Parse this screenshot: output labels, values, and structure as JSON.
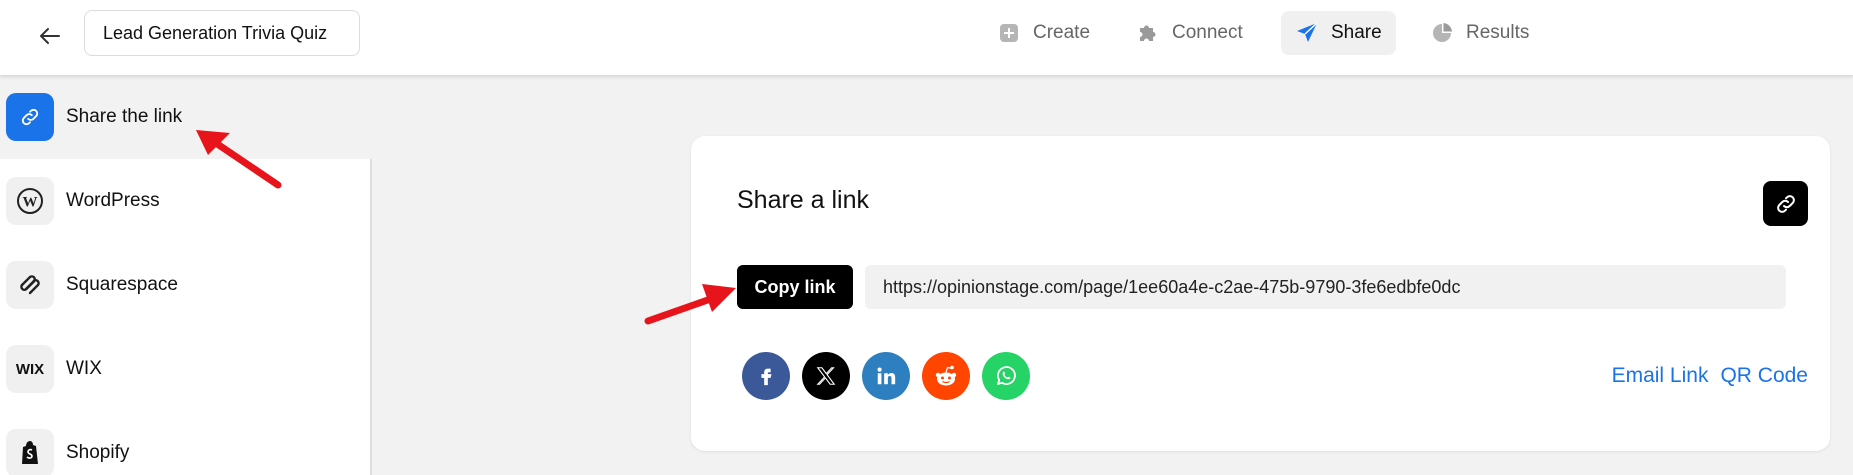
{
  "header": {
    "title": "Lead Generation Trivia Quiz",
    "nav": [
      {
        "label": "Create",
        "icon": "plus-square-icon",
        "active": false
      },
      {
        "label": "Connect",
        "icon": "puzzle-icon",
        "active": false
      },
      {
        "label": "Share",
        "icon": "paper-plane-icon",
        "active": true
      },
      {
        "label": "Results",
        "icon": "pie-chart-icon",
        "active": false
      }
    ]
  },
  "sidebar": {
    "items": [
      {
        "label": "Share the link",
        "icon": "link-icon",
        "active": true
      },
      {
        "label": "WordPress",
        "icon": "wordpress-icon",
        "active": false
      },
      {
        "label": "Squarespace",
        "icon": "squarespace-icon",
        "active": false
      },
      {
        "label": "WIX",
        "icon": "wix-icon",
        "icon_text": "WIX",
        "active": false
      },
      {
        "label": "Shopify",
        "icon": "shopify-icon",
        "active": false
      }
    ]
  },
  "share_card": {
    "title": "Share a link",
    "copy_label": "Copy link",
    "url": "https://opinionstage.com/page/1ee60a4e-c2ae-475b-9790-3fe6edbfe0dc",
    "socials": [
      {
        "name": "facebook-icon",
        "color": "#3b5998"
      },
      {
        "name": "x-icon",
        "color": "#000000"
      },
      {
        "name": "linkedin-icon",
        "color": "#2d7fbf"
      },
      {
        "name": "reddit-icon",
        "color": "#ff4500"
      },
      {
        "name": "whatsapp-icon",
        "color": "#25d366"
      }
    ],
    "email_link": "Email Link",
    "qr_code": "QR Code"
  },
  "colors": {
    "accent": "#1a73e8",
    "annotation_arrow": "#e8141b"
  }
}
